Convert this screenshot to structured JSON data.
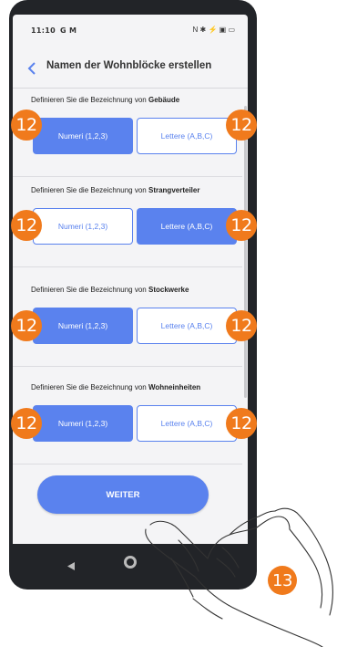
{
  "status": {
    "time": "11:10",
    "left_icons": "G M",
    "right_icons": "N ✱ ⚡ ▣ ▭"
  },
  "header": {
    "title": "Namen der Wohnblöcke erstellen"
  },
  "sections": [
    {
      "prefix": "Definieren Sie die Bezeichnung von ",
      "name": "Gebäude",
      "left": "Numeri (1,2,3)",
      "right": "Lettere (A,B,C)",
      "selected": "left"
    },
    {
      "prefix": "Definieren Sie die Bezeichnung von ",
      "name": "Strangverteiler",
      "left": "Numeri (1,2,3)",
      "right": "Lettere (A,B,C)",
      "selected": "right"
    },
    {
      "prefix": "Definieren Sie die Bezeichnung von ",
      "name": "Stockwerke",
      "left": "Numeri (1,2,3)",
      "right": "Lettere (A,B,C)",
      "selected": "left"
    },
    {
      "prefix": "Definieren Sie die Bezeichnung von ",
      "name": "Wohneinheiten",
      "left": "Numeri (1,2,3)",
      "right": "Lettere (A,B,C)",
      "selected": "left"
    }
  ],
  "weiter_label": "WEITER",
  "badges": {
    "option": "12",
    "next": "13"
  },
  "colors": {
    "accent": "#5a82ee",
    "badge": "#f07a1c"
  }
}
